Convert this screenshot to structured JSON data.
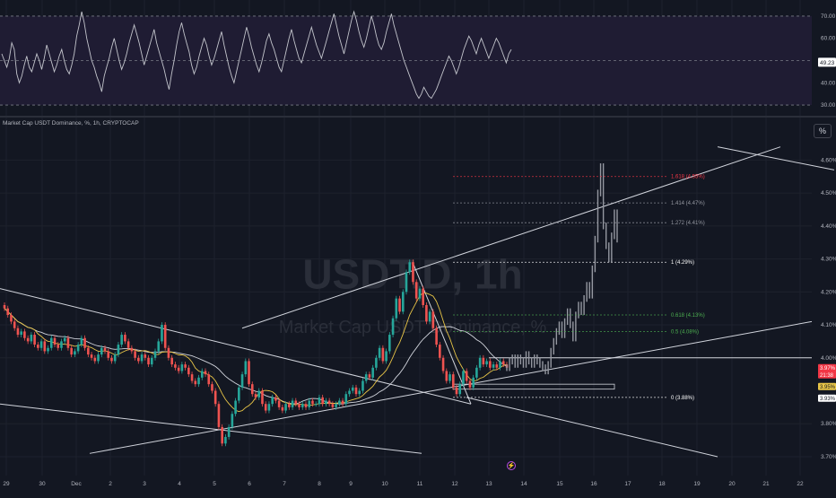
{
  "symbol_title": "Market Cap USDT Dominance, %, 1h, CRYPTOCAP",
  "percent_button": "%",
  "watermark": {
    "ticker": "USDT.D, 1h",
    "name": "Market Cap USDT Dominance, %"
  },
  "icons": {
    "alert": "lightning-icon"
  },
  "colors": {
    "background": "#131722",
    "grid": "#1e222d",
    "candle_up": "#26a69a",
    "candle_down": "#ef5350",
    "ma_fast": "#e8c547",
    "ma_slow": "#d1d4dc",
    "projection": "#9598a1",
    "rsi_line": "#c3c5cc",
    "rsi_band": "#1f1c33",
    "trendline": "#d1d4dc",
    "fib_red": "#f23645",
    "fib_green": "#4caf50"
  },
  "chart_data": [
    {
      "type": "line",
      "indicator": "RSI",
      "yticks": [
        "70.00",
        "60.00",
        "50.00",
        "40.00",
        "30.00"
      ],
      "ylim": [
        28,
        74
      ],
      "levels": [
        70,
        50,
        30
      ],
      "current_value": "49.23",
      "values": [
        53,
        50,
        47,
        51,
        58,
        55,
        44,
        40,
        43,
        48,
        52,
        47,
        45,
        49,
        53,
        50,
        46,
        51,
        57,
        53,
        49,
        45,
        48,
        52,
        55,
        50,
        46,
        44,
        48,
        53,
        61,
        66,
        72,
        67,
        60,
        55,
        50,
        47,
        43,
        40,
        36,
        43,
        47,
        51,
        56,
        60,
        55,
        50,
        46,
        49,
        53,
        58,
        62,
        66,
        62,
        58,
        53,
        48,
        52,
        56,
        60,
        64,
        58,
        54,
        50,
        46,
        41,
        37,
        44,
        50,
        57,
        63,
        67,
        62,
        58,
        54,
        48,
        44,
        47,
        52,
        56,
        60,
        57,
        52,
        48,
        51,
        55,
        59,
        63,
        57,
        52,
        47,
        43,
        40,
        45,
        50,
        55,
        60,
        65,
        61,
        56,
        52,
        48,
        45,
        49,
        54,
        59,
        62,
        58,
        55,
        51,
        47,
        45,
        50,
        55,
        60,
        64,
        59,
        55,
        51,
        49,
        53,
        57,
        61,
        65,
        61,
        57,
        54,
        51,
        55,
        59,
        63,
        67,
        71,
        66,
        61,
        57,
        53,
        58,
        63,
        68,
        72,
        68,
        63,
        59,
        56,
        60,
        65,
        70,
        66,
        61,
        57,
        55,
        58,
        63,
        67,
        71,
        66,
        62,
        58,
        54,
        50,
        47,
        44,
        41,
        38,
        35,
        33,
        35,
        38,
        36,
        34,
        33,
        35,
        37,
        40,
        43,
        46,
        49,
        52,
        50,
        47,
        44,
        47,
        51,
        55,
        58,
        61,
        59,
        56,
        53,
        57,
        60,
        57,
        54,
        51,
        54,
        57,
        60,
        58,
        55,
        52,
        49,
        53,
        55
      ]
    },
    {
      "type": "candlestick",
      "title": "Market Cap USDT Dominance, %, 1h, CRYPTOCAP",
      "x_labels": [
        "29",
        "30",
        "Dec",
        "2",
        "3",
        "4",
        "5",
        "6",
        "7",
        "8",
        "9",
        "10",
        "11",
        "12",
        "13",
        "14",
        "15",
        "16",
        "17",
        "18",
        "19",
        "20",
        "21",
        "22"
      ],
      "yticks": [
        "4.60%",
        "4.50%",
        "4.40%",
        "4.30%",
        "4.20%",
        "4.10%",
        "4.00%",
        "3.80%",
        "3.70%"
      ],
      "ylim": [
        3.67,
        4.65
      ],
      "price_labels": [
        {
          "value": 3.97,
          "text": "3.97%",
          "sub": "21:38",
          "color": "#f23645"
        },
        {
          "value": 3.95,
          "text": "3.95%",
          "color": "#e8c547"
        },
        {
          "value": 3.93,
          "text": "3.93%",
          "color": "#ffffff"
        }
      ],
      "fibonacci": [
        {
          "ratio_label": "1.618 (4.55%)",
          "value": 4.55,
          "color": "#f23645"
        },
        {
          "ratio_label": "1.414 (4.47%)",
          "value": 4.47,
          "color": "#9598a1"
        },
        {
          "ratio_label": "1.272 (4.41%)",
          "value": 4.41,
          "color": "#9598a1"
        },
        {
          "ratio_label": "1 (4.29%)",
          "value": 4.29,
          "color": "#ffffff"
        },
        {
          "ratio_label": "0.618 (4.13%)",
          "value": 4.13,
          "color": "#4caf50"
        },
        {
          "ratio_label": "0.5 (4.08%)",
          "value": 4.08,
          "color": "#4caf50"
        },
        {
          "ratio_label": "0 (3.88%)",
          "value": 3.88,
          "color": "#ffffff"
        }
      ],
      "close": [
        4.15,
        4.13,
        4.11,
        4.09,
        4.07,
        4.08,
        4.06,
        4.05,
        4.07,
        4.04,
        4.03,
        4.05,
        4.02,
        4.03,
        4.06,
        4.04,
        4.03,
        4.05,
        4.06,
        4.03,
        4.01,
        4.02,
        4.04,
        4.06,
        4.03,
        4.01,
        4.0,
        3.99,
        4.01,
        4.03,
        4.02,
        4.0,
        3.99,
        4.01,
        4.04,
        4.07,
        4.05,
        4.03,
        4.02,
        4.0,
        3.99,
        4.01,
        4.0,
        3.98,
        4.0,
        4.02,
        4.05,
        4.1,
        4.03,
        4.0,
        3.98,
        3.97,
        3.96,
        3.98,
        3.97,
        3.95,
        3.93,
        3.92,
        3.94,
        3.96,
        3.95,
        3.92,
        3.9,
        3.86,
        3.79,
        3.74,
        3.76,
        3.79,
        3.83,
        3.87,
        3.91,
        3.95,
        3.99,
        3.92,
        3.89,
        3.88,
        3.9,
        3.86,
        3.84,
        3.86,
        3.88,
        3.87,
        3.85,
        3.84,
        3.86,
        3.85,
        3.87,
        3.86,
        3.85,
        3.86,
        3.85,
        3.87,
        3.86,
        3.86,
        3.88,
        3.86,
        3.87,
        3.86,
        3.85,
        3.86,
        3.87,
        3.86,
        3.89,
        3.9,
        3.91,
        3.89,
        3.9,
        3.93,
        3.95,
        3.94,
        3.97,
        4.0,
        4.03,
        3.99,
        4.02,
        4.07,
        4.12,
        4.18,
        4.14,
        4.2,
        4.26,
        4.29,
        4.23,
        4.18,
        4.21,
        4.16,
        4.11,
        4.14,
        4.09,
        4.04,
        4.0,
        3.96,
        3.93,
        3.95,
        3.91,
        3.89,
        3.92,
        3.96,
        3.93,
        3.91,
        3.94,
        3.97,
        4.0,
        3.98,
        3.99,
        3.97,
        3.98,
        3.97,
        3.99,
        3.98,
        3.97
      ],
      "projection": [
        3.97,
        3.99,
        4.0,
        3.98,
        4.0,
        3.99,
        3.98,
        4.01,
        3.99,
        3.98,
        4.0,
        3.99,
        3.98,
        3.97,
        3.96,
        3.98,
        4.02,
        4.05,
        4.08,
        4.1,
        4.07,
        4.11,
        4.14,
        4.1,
        4.06,
        4.13,
        4.16,
        4.14,
        4.18,
        4.22,
        4.19,
        4.27,
        4.36,
        4.5,
        4.58,
        4.4,
        4.34,
        4.3,
        4.37,
        4.44,
        4.36
      ]
    }
  ]
}
